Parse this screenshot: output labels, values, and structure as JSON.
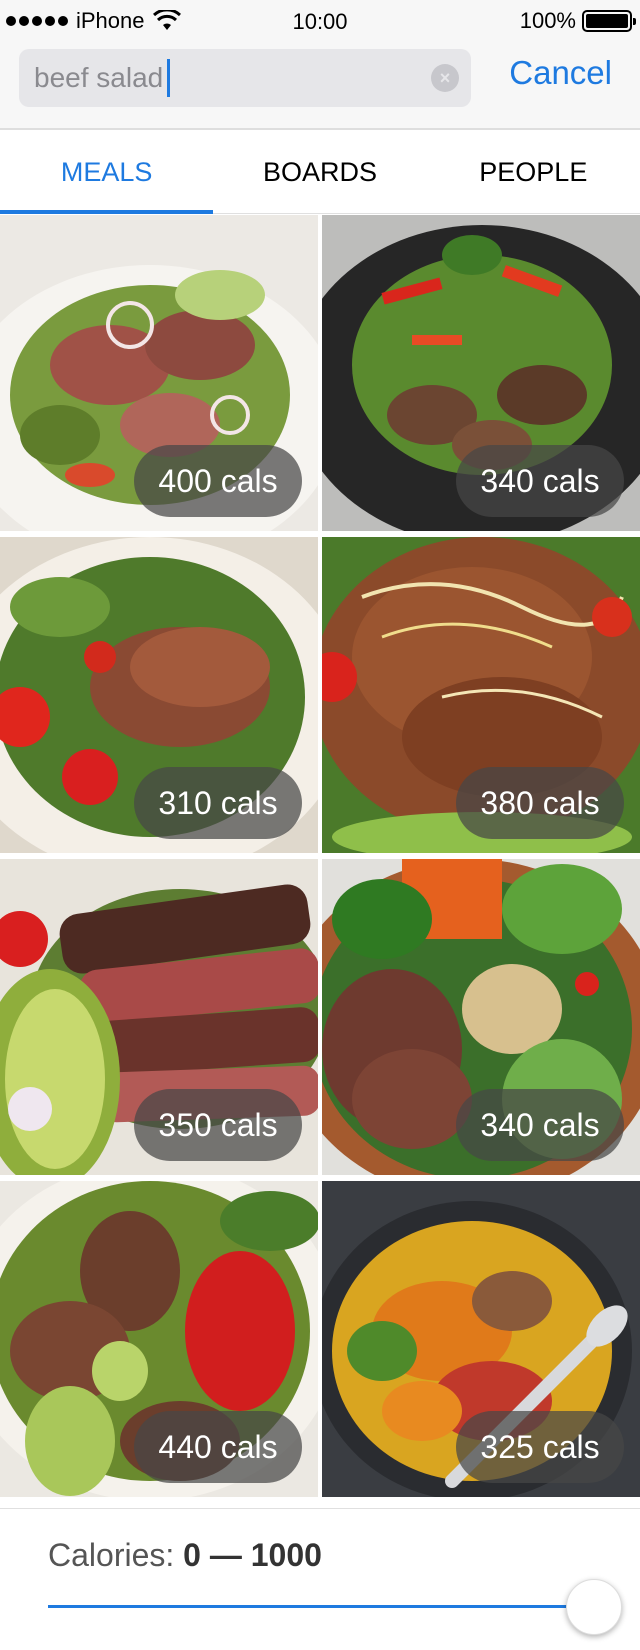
{
  "status_bar": {
    "carrier": "iPhone",
    "time": "10:00",
    "battery": "100%",
    "icons": [
      "signal-dots-icon",
      "wifi-icon",
      "battery-icon"
    ]
  },
  "search": {
    "value": "beef salad",
    "clear_icon": "clear-x-icon",
    "cancel_label": "Cancel"
  },
  "tabs": [
    {
      "label": "MEALS",
      "active": true
    },
    {
      "label": "BOARDS",
      "active": false
    },
    {
      "label": "PEOPLE",
      "active": false
    }
  ],
  "meals": [
    {
      "calories": "400 cals",
      "image": "beef-salad-plate-photo"
    },
    {
      "calories": "340 cals",
      "image": "beef-salad-dark-bowl-photo"
    },
    {
      "calories": "310 cals",
      "image": "steak-salad-tomatoes-photo"
    },
    {
      "calories": "380 cals",
      "image": "ground-beef-taco-salad-photo"
    },
    {
      "calories": "350 cals",
      "image": "sliced-steak-avocado-photo"
    },
    {
      "calories": "340 cals",
      "image": "beef-bowl-vegetables-photo"
    },
    {
      "calories": "440 cals",
      "image": "beef-cucumber-tomato-salad-photo"
    },
    {
      "calories": "325 cals",
      "image": "beef-bean-corn-salad-photo"
    }
  ],
  "filter": {
    "label": "Calories:",
    "range": "0 — 1000",
    "min": 0,
    "max": 1000,
    "current_min": 0,
    "current_max": 1000
  },
  "colors": {
    "accent": "#1e7ae0",
    "header_bg": "#f7f7f7",
    "badge_bg": "rgba(70,70,70,0.72)"
  }
}
